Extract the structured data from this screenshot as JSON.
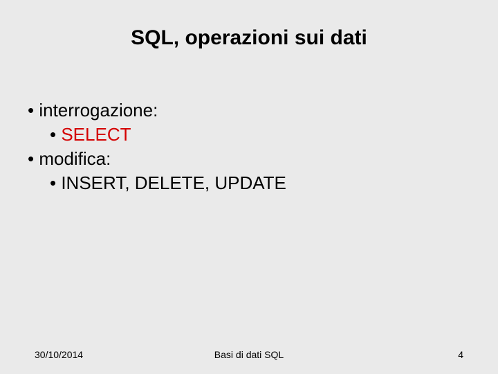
{
  "title": "SQL, operazioni sui dati",
  "bullets": {
    "interrogazione": "interrogazione:",
    "select": "SELECT",
    "modifica": "modifica:",
    "iud": "INSERT, DELETE, UPDATE"
  },
  "footer": {
    "date": "30/10/2014",
    "center": "Basi di dati  SQL",
    "page": "4"
  }
}
